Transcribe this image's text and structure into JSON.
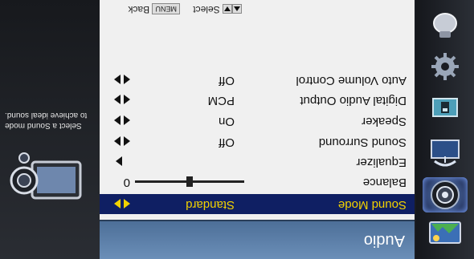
{
  "menu": {
    "title": "Audio",
    "items": [
      {
        "label": "Sound Mode",
        "value": "Standard",
        "control": "arrows",
        "selected": true
      },
      {
        "label": "Balance",
        "value": "0",
        "control": "slider",
        "slider_value": 0,
        "slider_min": -50,
        "slider_max": 50
      },
      {
        "label": "Equalizer",
        "value": "",
        "control": "arrow-right"
      },
      {
        "label": "Sound Surround",
        "value": "Off",
        "control": "arrows"
      },
      {
        "label": "Speaker",
        "value": "On",
        "control": "arrows"
      },
      {
        "label": "Digital Audio Output",
        "value": "PCM",
        "control": "arrows"
      },
      {
        "label": "Auto Volume Control",
        "value": "Off",
        "control": "arrows"
      }
    ]
  },
  "hints": {
    "select_label": "Select",
    "menu_key": "MENU",
    "back_label": "Back"
  },
  "info": {
    "description": "Select a Sound mode to achieve ideal sound."
  },
  "categories": [
    {
      "name": "picture-category",
      "icon": "picture-icon"
    },
    {
      "name": "audio-category",
      "icon": "speaker-icon",
      "selected": true
    },
    {
      "name": "channel-category",
      "icon": "satellite-dish-icon"
    },
    {
      "name": "lock-category",
      "icon": "lock-icon"
    },
    {
      "name": "setup-category",
      "icon": "gear-icon"
    },
    {
      "name": "help-category",
      "icon": "help-icon"
    }
  ],
  "colors": {
    "selected_row_bg": "#0f1f63",
    "selected_text": "#f2d200",
    "title_bar": "#5a7fa8"
  }
}
